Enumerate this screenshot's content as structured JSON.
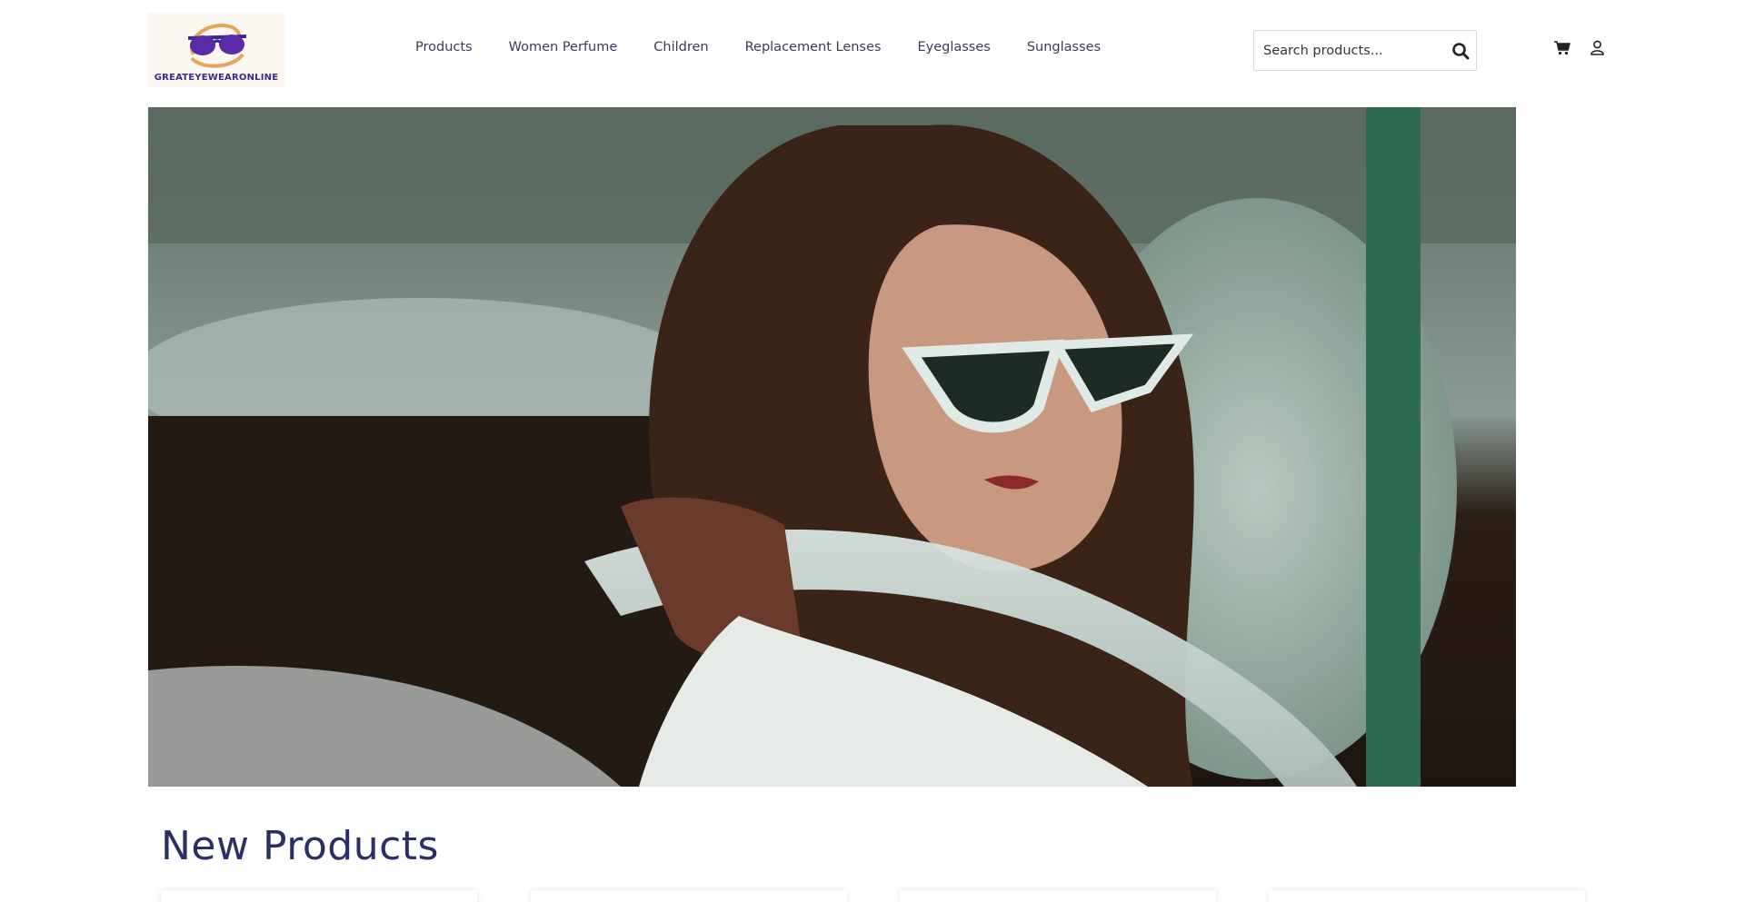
{
  "brand": {
    "logo_text": "GREATEYEWEARONLINE",
    "accent_color": "#3a2a8f"
  },
  "nav": {
    "items": [
      {
        "label": "Products"
      },
      {
        "label": "Women Perfume"
      },
      {
        "label": "Children"
      },
      {
        "label": "Replacement Lenses"
      },
      {
        "label": "Eyeglasses"
      },
      {
        "label": "Sunglasses"
      }
    ]
  },
  "search": {
    "placeholder": "Search products...",
    "icon": "search-icon"
  },
  "header_icons": {
    "cart": "cart-icon",
    "account": "user-icon"
  },
  "hero": {
    "image_description": "woman in white cat-eye sunglasses driving"
  },
  "new_products": {
    "title": "New Products",
    "cards": [
      {
        "id": "card-1"
      },
      {
        "id": "card-2"
      },
      {
        "id": "card-3"
      },
      {
        "id": "card-4"
      }
    ]
  }
}
